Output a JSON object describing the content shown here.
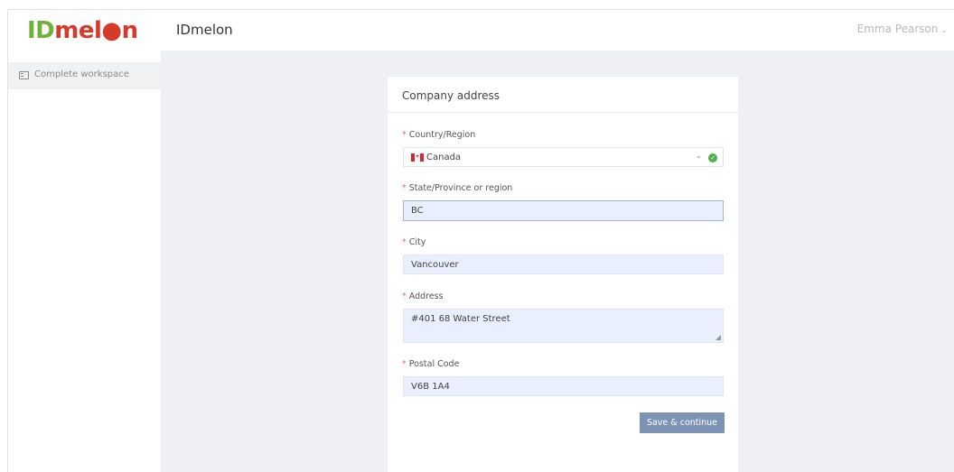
{
  "header": {
    "logo_text_1": "ID",
    "logo_text_2": "mel",
    "logo_text_3": "n",
    "app_title": "IDmelon",
    "user_name": "Emma Pearson",
    "user_chevron": "⌄"
  },
  "sidebar": {
    "items": [
      {
        "label": "Complete workspace",
        "icon": "workspace-icon"
      }
    ]
  },
  "form": {
    "title": "Company address",
    "required_mark": "*",
    "country": {
      "label": "Country/Region",
      "value": "Canada",
      "chevron": "⌄",
      "status_icon": "check-circle-icon",
      "status_color": "#4caf50"
    },
    "state": {
      "label": "State/Province or region",
      "value": "BC"
    },
    "city": {
      "label": "City",
      "value": "Vancouver"
    },
    "address": {
      "label": "Address",
      "value": "#401 68 Water Street"
    },
    "postal": {
      "label": "Postal Code",
      "value": "V6B 1A4"
    },
    "submit_label": "Save & continue"
  },
  "colors": {
    "logo_green": "#6fb23a",
    "logo_red": "#d63a2a",
    "button": "#7d93b5",
    "input_bg": "#e9effc",
    "page_bg": "#eef0f3"
  }
}
